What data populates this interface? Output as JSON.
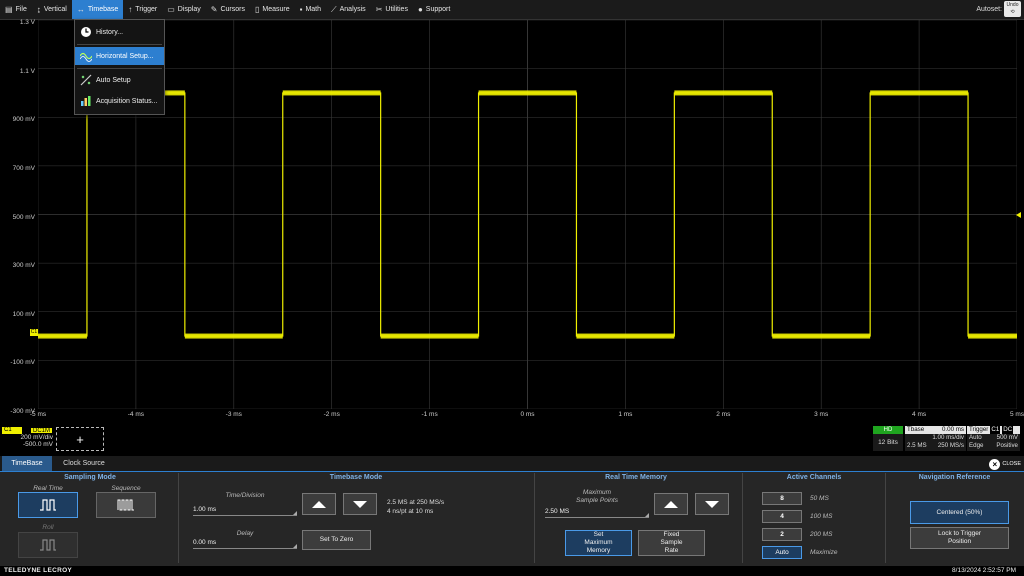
{
  "menu": {
    "items": [
      {
        "label": "File",
        "icon": "file-icon"
      },
      {
        "label": "Vertical",
        "icon": "vertical-icon"
      },
      {
        "label": "Timebase",
        "icon": "timebase-icon"
      },
      {
        "label": "Trigger",
        "icon": "trigger-icon"
      },
      {
        "label": "Display",
        "icon": "display-icon"
      },
      {
        "label": "Cursors",
        "icon": "cursors-icon"
      },
      {
        "label": "Measure",
        "icon": "measure-icon"
      },
      {
        "label": "Math",
        "icon": "math-icon"
      },
      {
        "label": "Analysis",
        "icon": "analysis-icon"
      },
      {
        "label": "Utilities",
        "icon": "utilities-icon"
      },
      {
        "label": "Support",
        "icon": "support-icon"
      }
    ],
    "active_index": 2,
    "autoset_label": "Autoset:",
    "undo_label": "Undo"
  },
  "timebase_menu": {
    "items": [
      {
        "label": "History...",
        "icon": "history-icon"
      },
      {
        "label": "Horizontal Setup...",
        "icon": "horizontal-setup-icon"
      },
      {
        "label": "Auto Setup",
        "icon": "auto-setup-icon"
      },
      {
        "label": "Acquisition Status...",
        "icon": "acquisition-status-icon"
      }
    ],
    "active_index": 1
  },
  "grid": {
    "y_labels": [
      "1.3 V",
      "1.1 V",
      "900 mV",
      "700 mV",
      "500 mV",
      "300 mV",
      "100 mV",
      "-100 mV",
      "-300 mV"
    ],
    "x_labels": [
      "-5 ms",
      "-4 ms",
      "-3 ms",
      "-2 ms",
      "-1 ms",
      "0 ms",
      "1 ms",
      "2 ms",
      "3 ms",
      "4 ms",
      "5 ms"
    ],
    "trace_color": "#f0f000",
    "channel_marker": "C1"
  },
  "waveform": {
    "type": "square",
    "high_v": 1.0,
    "low_v": 0.0,
    "period_ms": 2.0,
    "t_start_ms": -5,
    "t_end_ms": 5,
    "v_top": 1.3,
    "v_bottom": -0.3,
    "first_rise_ms": -4.5
  },
  "channel": {
    "name": "C1",
    "coupling": "DC1M",
    "scale": "200 mV/div",
    "offset": "-500.0 mV",
    "color": "#f0f000"
  },
  "add_channel_label": "+",
  "acq": {
    "hd_label": "HD",
    "bits": "12 Bits",
    "tbase_label": "Tbase",
    "tbase_delay": "0.00 ms",
    "tbase_div": "1.00 ms/div",
    "tbase_samples": "2.5 MS",
    "tbase_rate": "250 MS/s",
    "trigger_label": "Trigger",
    "trigger_ch": "C1",
    "trigger_coupling": "DC",
    "trigger_mode": "Auto",
    "trigger_level": "500 mV",
    "trigger_type": "Edge",
    "trigger_slope": "Positive"
  },
  "panel": {
    "tabs": [
      "TimeBase",
      "Clock Source"
    ],
    "active_tab": 0,
    "close_label": "CLOSE",
    "sampling_mode": {
      "title": "Sampling Mode",
      "realtime_label": "Real Time",
      "sequence_label": "Sequence",
      "roll_label": "Roll"
    },
    "timebase_mode": {
      "title": "Timebase Mode",
      "time_div_label": "Time/Division",
      "time_div_value": "1.00 ms",
      "delay_label": "Delay",
      "delay_value": "0.00 ms",
      "info_line1": "2.5 MS at 250 MS/s",
      "info_line2": "4 ns/pt at 10 ms",
      "set_to_zero": "Set To Zero"
    },
    "memory": {
      "title": "Real Time Memory",
      "max_label_line1": "Maximum",
      "max_label_line2": "Sample Points",
      "max_value": "2.50 MS",
      "set_max_line1": "Set",
      "set_max_line2": "Maximum",
      "set_max_line3": "Memory",
      "fixed_line1": "Fixed",
      "fixed_line2": "Sample",
      "fixed_line3": "Rate"
    },
    "active_channels": {
      "title": "Active Channels",
      "options": [
        {
          "button": "8",
          "rate": "50 MS"
        },
        {
          "button": "4",
          "rate": "100 MS"
        },
        {
          "button": "2",
          "rate": "200 MS"
        },
        {
          "button": "Auto",
          "rate": "Maximize"
        }
      ]
    },
    "nav_ref": {
      "title": "Navigation Reference",
      "centered": "Centered (50%)",
      "lock_line1": "Lock to Trigger",
      "lock_line2": "Position"
    }
  },
  "status": {
    "brand": "TELEDYNE LECROY",
    "datetime": "8/13/2024 2:52:57 PM"
  }
}
